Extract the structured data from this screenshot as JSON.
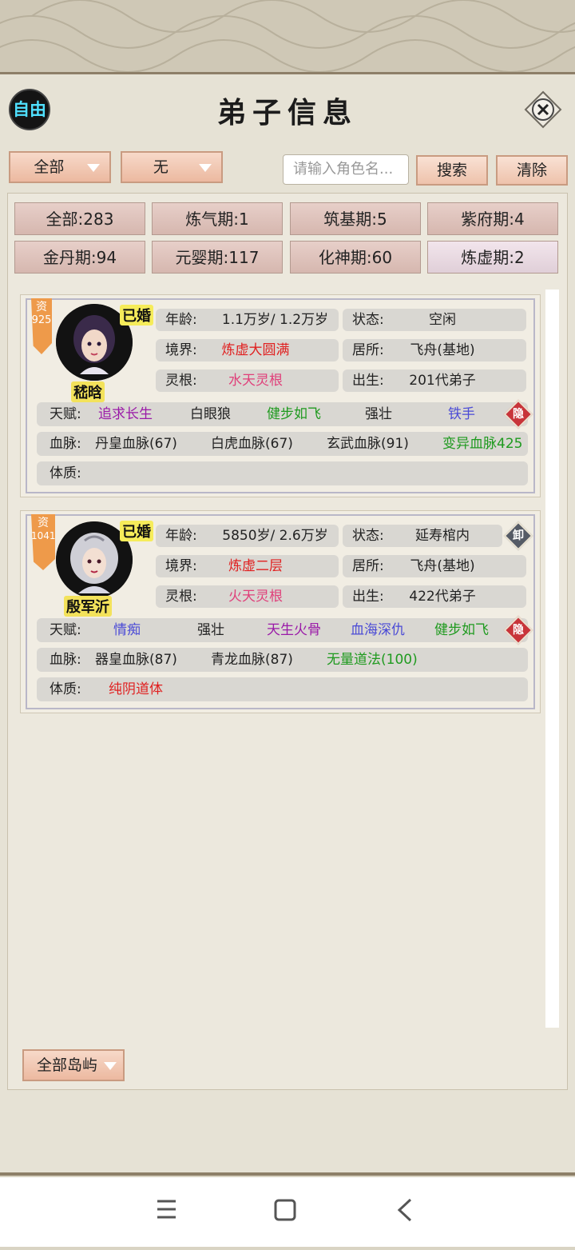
{
  "header": {
    "title": "弟子信息",
    "free_label": "自由"
  },
  "filters": {
    "category": "全部",
    "secondary": "无",
    "search_placeholder": "请输入角色名...",
    "search_label": "搜索",
    "clear_label": "清除"
  },
  "tabs": [
    {
      "label": "全部:283"
    },
    {
      "label": "炼气期:1"
    },
    {
      "label": "筑基期:5"
    },
    {
      "label": "紫府期:4"
    },
    {
      "label": "金丹期:94"
    },
    {
      "label": "元婴期:117"
    },
    {
      "label": "化神期:60"
    },
    {
      "label": "炼虚期:2"
    }
  ],
  "disciples": [
    {
      "zi_label": "资",
      "zi_value": "925",
      "married": "已婚",
      "name": "嵇晗",
      "age_key": "年龄:",
      "age": "1.1万岁/ 1.2万岁",
      "status_key": "状态:",
      "status": "空闲",
      "realm_key": "境界:",
      "realm": "炼虚大圆满",
      "residence_key": "居所:",
      "residence": "飞舟(基地)",
      "root_key": "灵根:",
      "root": "水天灵根",
      "birth_key": "出生:",
      "birth": "201代弟子",
      "talent_key": "天赋:",
      "talents": [
        "追求长生",
        "白眼狼",
        "健步如飞",
        "强壮",
        "铁手"
      ],
      "hide_label": "隐",
      "blood_key": "血脉:",
      "bloodlines": [
        "丹皇血脉(67)",
        "白虎血脉(67)",
        "玄武血脉(91)",
        "变异血脉425"
      ],
      "physique_key": "体质:",
      "physique": ""
    },
    {
      "zi_label": "资",
      "zi_value": "1041",
      "married": "已婚",
      "name": "殷军沂",
      "age_key": "年龄:",
      "age": "5850岁/ 2.6万岁",
      "status_key": "状态:",
      "status": "延寿棺内",
      "unload_label": "卸",
      "realm_key": "境界:",
      "realm": "炼虚二层",
      "residence_key": "居所:",
      "residence": "飞舟(基地)",
      "root_key": "灵根:",
      "root": "火天灵根",
      "birth_key": "出生:",
      "birth": "422代弟子",
      "talent_key": "天赋:",
      "talents": [
        "情痴",
        "强壮",
        "天生火骨",
        "血海深仇",
        "健步如飞"
      ],
      "hide_label": "隐",
      "blood_key": "血脉:",
      "bloodlines": [
        "器皇血脉(87)",
        "青龙血脉(87)",
        "无量道法(100)"
      ],
      "physique_key": "体质:",
      "physique": "纯阴道体"
    }
  ],
  "footer": {
    "island_filter": "全部岛屿"
  },
  "colors": {
    "red_text": "#e02020",
    "pink_text": "#e0407a",
    "purple_text": "#9a1aa8",
    "green_text": "#1f9a1f",
    "blue_text": "#4b4bd6",
    "free_text": "#4fe0ff"
  }
}
